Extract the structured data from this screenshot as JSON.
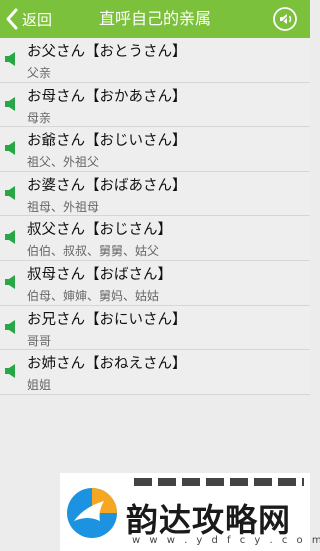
{
  "header": {
    "back_label": "返回",
    "title": "直呼自己的亲属"
  },
  "colors": {
    "title_bar": "#7cc13b",
    "speaker": "#29a645"
  },
  "items": [
    {
      "japanese": "お父さん【おとうさん】",
      "chinese": "父亲"
    },
    {
      "japanese": "お母さん【おかあさん】",
      "chinese": "母亲"
    },
    {
      "japanese": "お爺さん【おじいさん】",
      "chinese": "祖父、外祖父"
    },
    {
      "japanese": "お婆さん【おばあさん】",
      "chinese": "祖母、外祖母"
    },
    {
      "japanese": "叔父さん【おじさん】",
      "chinese": "伯伯、叔叔、舅舅、姑父"
    },
    {
      "japanese": "叔母さん【おばさん】",
      "chinese": "伯母、婶婶、舅妈、姑姑"
    },
    {
      "japanese": "お兄さん【おにいさん】",
      "chinese": "哥哥"
    },
    {
      "japanese": "お姉さん【おねえさん】",
      "chinese": "姐姐"
    }
  ],
  "watermark": {
    "text": "韵达攻略网",
    "url": "w w w . y d f c y . c o m"
  }
}
